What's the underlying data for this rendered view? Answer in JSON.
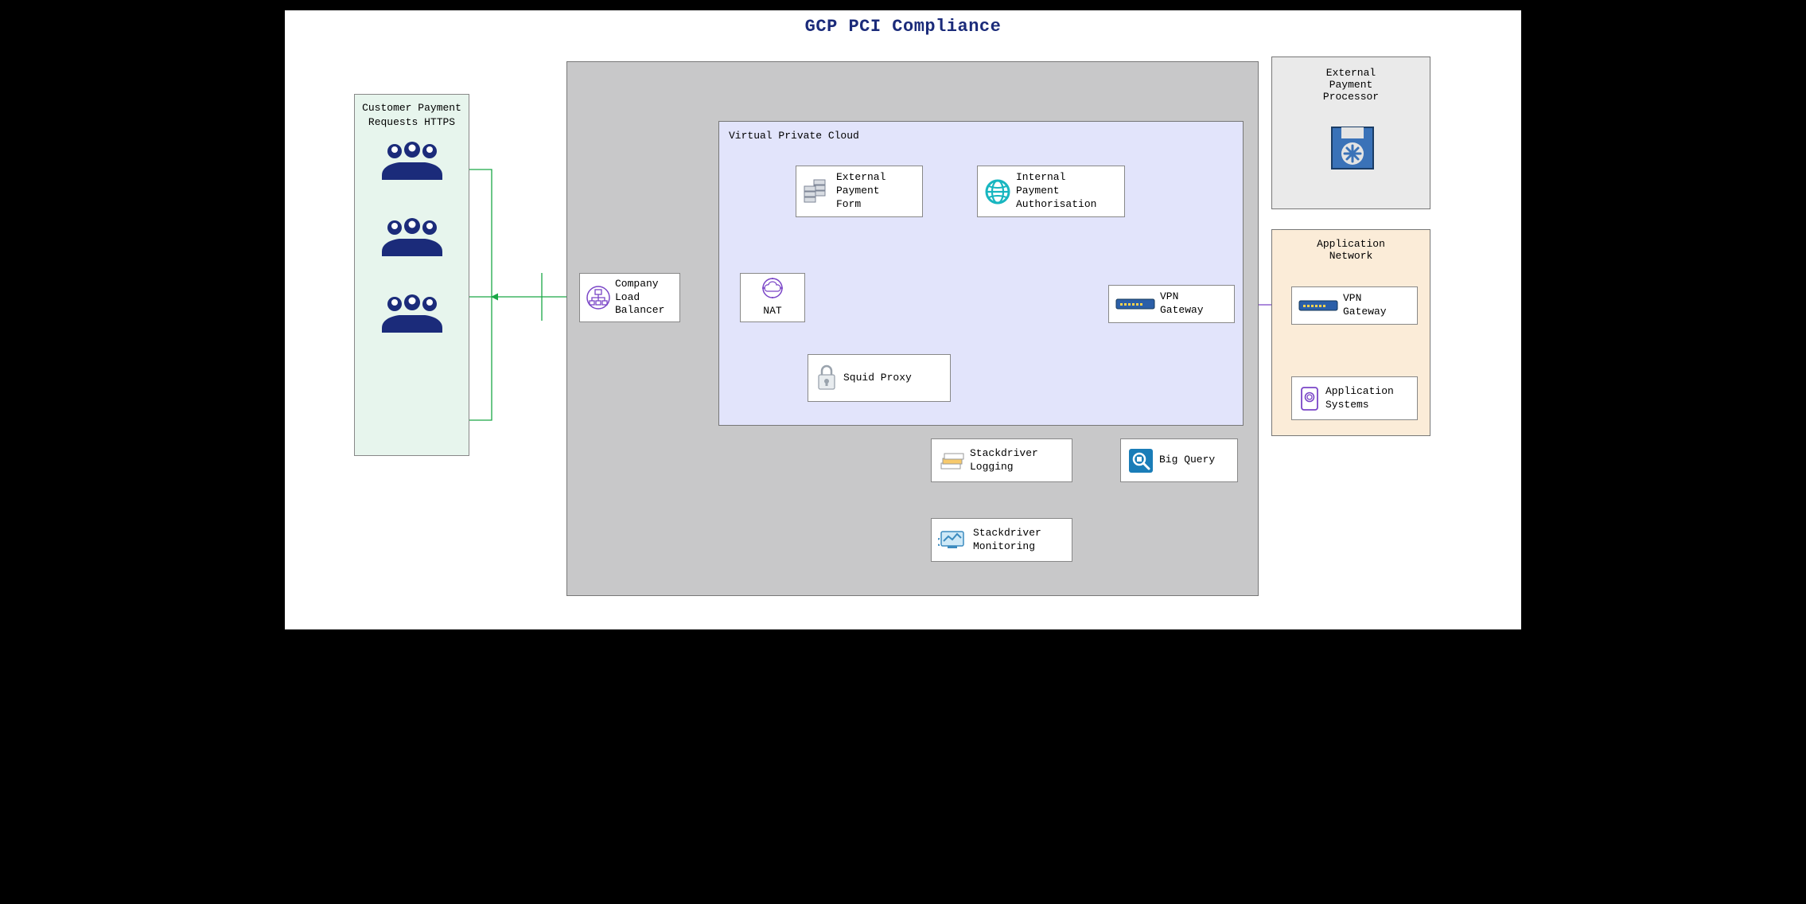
{
  "title": "GCP PCI Compliance",
  "customer": {
    "title": "Customer\nPayment\nRequests\nHTTPS"
  },
  "vpc": {
    "label": "Virtual Private Cloud"
  },
  "nodes": {
    "load_balancer": "Company\nLoad\nBalancer",
    "nat": "NAT",
    "external_payment_form": "External\nPayment\nForm",
    "internal_payment_auth": "Internal\nPayment\nAuthorisation",
    "squid_proxy": "Squid Proxy",
    "vpn_gateway_gcp": "VPN Gateway",
    "stackdriver_logging": "Stackdriver\nLogging",
    "stackdriver_monitoring": "Stackdriver\nMonitoring",
    "big_query": "Big Query",
    "external_payment_processor_label": "External\nPayment\nProcessor",
    "application_network_label": "Application\nNetwork",
    "vpn_gateway_app": "VPN Gateway",
    "application_systems": "Application\nSystems"
  },
  "colors": {
    "green": "#1aa846",
    "purple": "#7a45c7",
    "black": "#333333",
    "title": "#1b2b7a"
  },
  "edges": [
    {
      "id": "cust-to-lb",
      "from": "customer",
      "to": "load_balancer",
      "color": "green",
      "bidir": true
    },
    {
      "id": "lb-to-nat",
      "from": "load_balancer",
      "to": "nat",
      "color": "green",
      "bidir": true
    },
    {
      "id": "nat-to-epf",
      "from": "nat",
      "to": "external_payment_form",
      "color": "green",
      "bidir": true
    },
    {
      "id": "epf-to-externalproc",
      "from": "external_payment_form",
      "to": "external_payment_processor",
      "via": "top",
      "color": "green",
      "bidir": true
    },
    {
      "id": "ipa-to-externalproc",
      "from": "internal_payment_auth",
      "to": "external_payment_processor",
      "via": "top",
      "color": "purple",
      "bidir": true
    },
    {
      "id": "ipa-to-vpn-gcp",
      "from": "internal_payment_auth",
      "to": "vpn_gateway_gcp",
      "color": "black",
      "bidir": false
    },
    {
      "id": "vpn-gcp-to-vpn-app",
      "from": "vpn_gateway_gcp",
      "to": "vpn_gateway_app",
      "color": "purple",
      "bidir": true
    },
    {
      "id": "appsys-to-vpn-app",
      "from": "application_systems",
      "to": "vpn_gateway_app",
      "color": "purple",
      "bidir": false
    },
    {
      "id": "vpn-gcp-to-ipa",
      "from": "vpn_gateway_gcp",
      "to": "internal_payment_auth",
      "via": "right-up",
      "color": "purple",
      "bidir": false
    },
    {
      "id": "nat-to-squid",
      "from": "nat",
      "to": "squid_proxy",
      "color": "black",
      "bidir": true
    },
    {
      "id": "epf-to-squid1",
      "from": "external_payment_form",
      "to": "squid_proxy",
      "color": "black",
      "bidir": false
    },
    {
      "id": "epf-to-squid2",
      "from": "external_payment_form",
      "to": "squid_proxy",
      "color": "black",
      "bidir": false
    },
    {
      "id": "ipa-to-squid",
      "from": "internal_payment_auth",
      "to": "squid_proxy",
      "color": "black",
      "bidir": false
    },
    {
      "id": "vpn-to-squid",
      "from": "vpn_gateway_gcp",
      "to": "squid_proxy",
      "color": "black",
      "bidir": false
    },
    {
      "id": "squid-to-logging",
      "from": "squid_proxy",
      "to": "stackdriver_logging",
      "color": "black",
      "bidir": false
    },
    {
      "id": "squid-to-monitoring",
      "from": "squid_proxy",
      "to": "stackdriver_monitoring",
      "color": "black",
      "bidir": false
    },
    {
      "id": "logging-to-bigquery",
      "from": "stackdriver_logging",
      "to": "big_query",
      "color": "black",
      "bidir": false
    }
  ]
}
